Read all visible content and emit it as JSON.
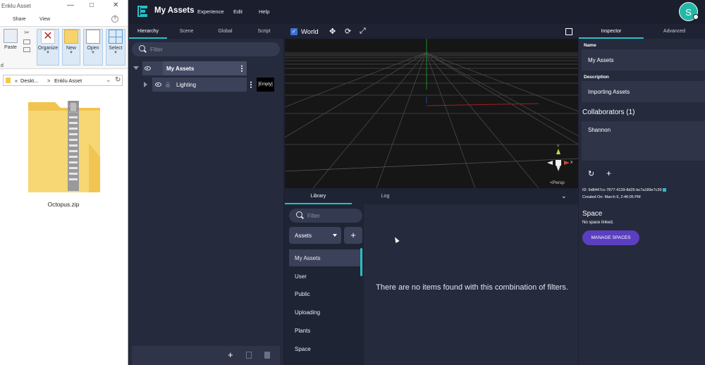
{
  "explorer": {
    "window_title": "Enklu Asset",
    "tabs": [
      "Share",
      "View"
    ],
    "ribbon": {
      "paste": "Paste",
      "organize": "Organize",
      "new": "New",
      "open": "Open",
      "select": "Select"
    },
    "address": {
      "path_prefix": "«",
      "path_1": "Deskt...",
      "separator": ">",
      "path_2": "Enklu Asset"
    },
    "file": {
      "name": "Octopus.zip"
    },
    "side_marker": "d"
  },
  "app": {
    "title": "My Assets",
    "menu": [
      "Experience",
      "Edit",
      "Help"
    ],
    "avatar_initial": "S",
    "accent": "#27c0c6",
    "brand_purple": "#5a3fc0"
  },
  "hierarchy": {
    "tabs": [
      "Hierarchy",
      "Scene",
      "Global",
      "Script"
    ],
    "active_tab": "Hierarchy",
    "filter_placeholder": "Filter",
    "rows": [
      {
        "label": "My Assets",
        "expanded": true
      },
      {
        "label": "Lighting",
        "expanded": false,
        "tag": "[Empty]"
      }
    ]
  },
  "viewport": {
    "space_label": "World",
    "persp_label": "Persp",
    "gizmo_axes": {
      "y": "Y",
      "x": "X"
    }
  },
  "library": {
    "tabs": [
      "Library",
      "Log"
    ],
    "active_tab": "Library",
    "filter_placeholder": "Filter",
    "dropdown_value": "Assets",
    "add_label": "+",
    "items": [
      "My Assets",
      "User",
      "Public",
      "Uploading",
      "Plants",
      "Space"
    ],
    "active_item": "My Assets",
    "empty_message": "There are no items found with this combination of filters."
  },
  "inspector": {
    "tabs": [
      "Inspector",
      "Advanced"
    ],
    "active_tab": "Inspector",
    "name_label": "Name",
    "name_value": "My Assets",
    "description_label": "Description",
    "description_value": "Importing Assets",
    "collaborators_heading": "Collaborators (1)",
    "collaborators": [
      "Shannon"
    ],
    "id_text": "ID: 9d8447cc-7877-4139-8d25-bc7a189e7c39",
    "created_text": "Created On: March 9, 2:46:05 PM",
    "space_heading": "Space",
    "space_status": "No space linked.",
    "manage_button": "MANAGE SPACES"
  }
}
